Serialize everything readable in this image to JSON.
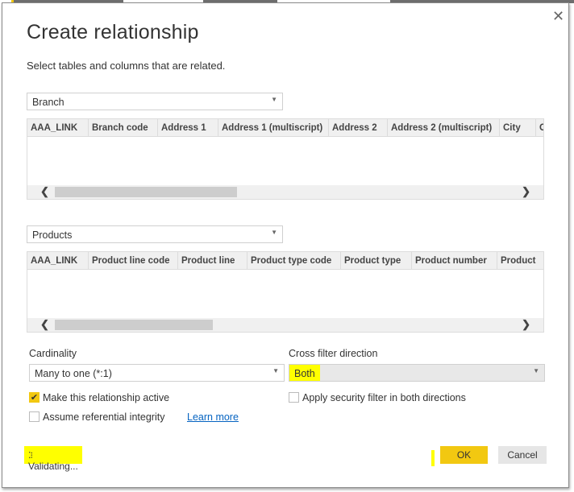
{
  "colors": {
    "accent": "#f2c811",
    "highlight": "#ffff00",
    "link": "#0563c1"
  },
  "dialog": {
    "title": "Create relationship",
    "subtitle": "Select tables and columns that are related.",
    "close_icon": "close-icon"
  },
  "table1": {
    "selected": "Branch",
    "columns": [
      "AAA_LINK",
      "Branch code",
      "Address 1",
      "Address 1 (multiscript)",
      "Address 2",
      "Address 2 (multiscript)",
      "City",
      "C"
    ]
  },
  "table2": {
    "selected": "Products",
    "columns": [
      "AAA_LINK",
      "Product line code",
      "Product line",
      "Product type code",
      "Product type",
      "Product number",
      "Product"
    ]
  },
  "cardinality": {
    "label": "Cardinality",
    "value": "Many to one (*:1)"
  },
  "cross_filter": {
    "label": "Cross filter direction",
    "value": "Both"
  },
  "options": {
    "active": {
      "label": "Make this relationship active",
      "checked": true
    },
    "security": {
      "label": "Apply security filter in both directions",
      "checked": false
    },
    "integrity": {
      "label": "Assume referential integrity",
      "checked": false
    },
    "learn_more": "Learn more"
  },
  "status": "Validating...",
  "buttons": {
    "ok": "OK",
    "cancel": "Cancel"
  }
}
